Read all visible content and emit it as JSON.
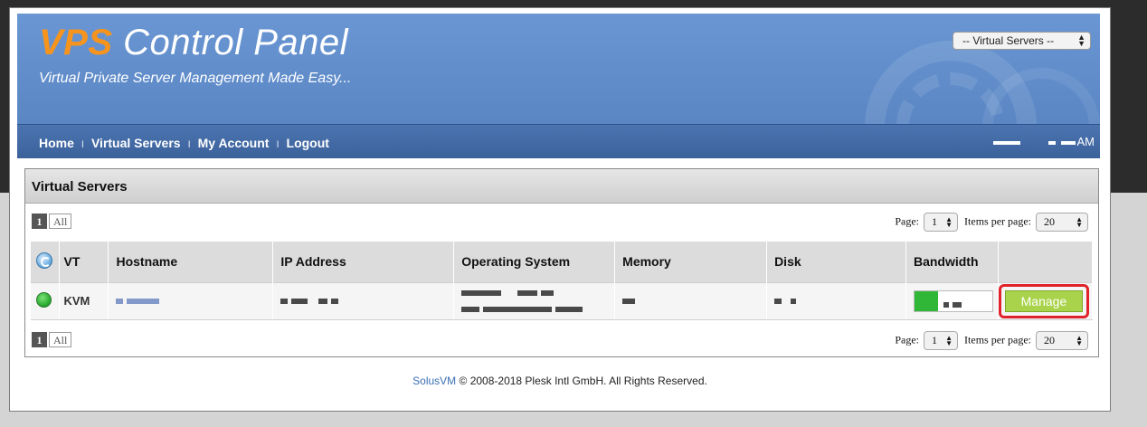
{
  "header": {
    "title_accent": "VPS",
    "title_rest": " Control Panel",
    "subtitle": "Virtual Private Server Management Made Easy...",
    "server_select": "-- Virtual Servers --"
  },
  "nav": {
    "items": [
      "Home",
      "Virtual Servers",
      "My Account",
      "Logout"
    ],
    "separator": "I",
    "right_text_suffix": "AM"
  },
  "panel": {
    "title": "Virtual Servers",
    "pager": {
      "current": "1",
      "all": "All"
    },
    "page_label": "Page:",
    "page_value": "1",
    "items_label": "Items per page:",
    "items_value": "20"
  },
  "table": {
    "columns": [
      "",
      "VT",
      "Hostname",
      "IP Address",
      "Operating System",
      "Memory",
      "Disk",
      "Bandwidth",
      ""
    ],
    "rows": [
      {
        "vt": "KVM",
        "manage": "Manage"
      }
    ]
  },
  "footer": {
    "brand": "SolusVM",
    "text": " © 2008-2018 Plesk Intl GmbH. All Rights Reserved."
  },
  "colors": {
    "header_bg": "#5e8ac8",
    "nav_bg": "#3c629b",
    "accent_orange": "#f7941d",
    "manage_green": "#a9d34a",
    "highlight_red": "#e0232b"
  }
}
